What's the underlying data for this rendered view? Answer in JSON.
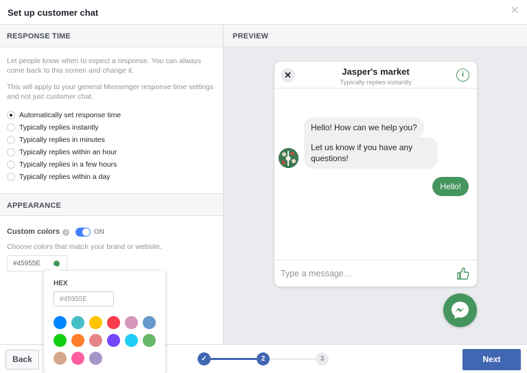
{
  "dialog": {
    "title": "Set up customer chat",
    "close_glyph": "✕"
  },
  "response_time": {
    "header": "RESPONSE TIME",
    "desc1": "Let people know when to expect a response. You can always come back to this screen and change it.",
    "desc2": "This will apply to your general Messenger response time settings and not just customer chat.",
    "options": [
      {
        "label": "Automatically set response time",
        "selected": true
      },
      {
        "label": "Typically replies instantly",
        "selected": false
      },
      {
        "label": "Typically replies in minutes",
        "selected": false
      },
      {
        "label": "Typically replies within an hour",
        "selected": false
      },
      {
        "label": "Typically replies in a few hours",
        "selected": false
      },
      {
        "label": "Typically replies within a day",
        "selected": false
      }
    ]
  },
  "appearance": {
    "header": "APPEARANCE",
    "custom_colors_label": "Custom colors",
    "help_glyph": "i",
    "toggle_state": "ON",
    "hint": "Choose colors that match your brand or website.",
    "hex_value": "#45955E",
    "selected_color": "#45955e"
  },
  "picker": {
    "hex_label": "HEX",
    "hex_placeholder": "#45955E",
    "swatches": [
      "#0084ff",
      "#44bec7",
      "#ffc300",
      "#fa3c4c",
      "#d696bb",
      "#6699cc",
      "#13cf13",
      "#ff7e29",
      "#e68585",
      "#7646ff",
      "#20cef5",
      "#67b868",
      "#d4a88c",
      "#ff5ca1",
      "#a695c7"
    ]
  },
  "preview": {
    "header": "PREVIEW",
    "chat": {
      "name": "Jasper's market",
      "subtitle": "Typically replies instantly",
      "close_glyph": "✕",
      "info_glyph": "i",
      "bubble1": "Hello! How can we help you?",
      "bubble2": "Let us know if you have any questions!",
      "my_bubble": "Hello!",
      "compose_placeholder": "Type a message…"
    }
  },
  "footer": {
    "back_label": "Back",
    "next_label": "Next",
    "steps": [
      {
        "label": "✓",
        "state": "done"
      },
      {
        "label": "2",
        "state": "current"
      },
      {
        "label": "3",
        "state": "pending"
      }
    ]
  }
}
